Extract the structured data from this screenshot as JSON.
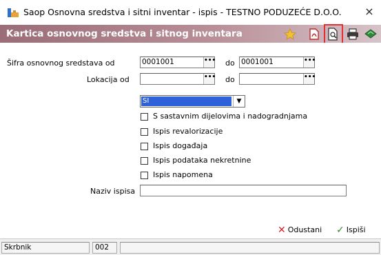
{
  "window": {
    "title": "Saop Osnovna sredstva i sitni inventar - ispis - TESTNO PODUZEĆE D.O.O.",
    "close_label": "×"
  },
  "header": {
    "title": "Kartica osnovnog sredstva i sitnog inventara",
    "toolbar_icons": [
      "favorite-star-icon",
      "pdf-export-icon",
      "print-preview-icon",
      "printer-icon",
      "export-icon"
    ]
  },
  "form": {
    "sifra_label": "Šifra osnovnog sredstava od",
    "sifra_from": "0001001",
    "sifra_do_label": "do",
    "sifra_to": "0001001",
    "lokacija_label": "Lokacija od",
    "lokacija_from": "",
    "lokacija_do_label": "do",
    "lokacija_to": "",
    "select_value": "SI",
    "lookup_button": "•••",
    "checkboxes": [
      {
        "label": "S sastavnim dijelovima i nadogradnjama",
        "checked": false
      },
      {
        "label": "Ispis revalorizacije",
        "checked": false
      },
      {
        "label": "Ispis događaja",
        "checked": false
      },
      {
        "label": "Ispis podataka nekretnine",
        "checked": false
      },
      {
        "label": "Ispis napomena",
        "checked": false
      }
    ],
    "naziv_label": "Naziv ispisa",
    "naziv_value": ""
  },
  "buttons": {
    "cancel_label": "Odustani",
    "print_label": "Ispiši"
  },
  "status": {
    "user_label": "Skrbnik",
    "user_value": "002",
    "extra": ""
  },
  "colors": {
    "header_gradient_start": "#9a6d78",
    "header_gradient_end": "#d6c3c8",
    "selection": "#2f62d8",
    "highlight_box": "#e03030",
    "cancel_x": "#d42020",
    "ok_check": "#2a8a2a"
  }
}
